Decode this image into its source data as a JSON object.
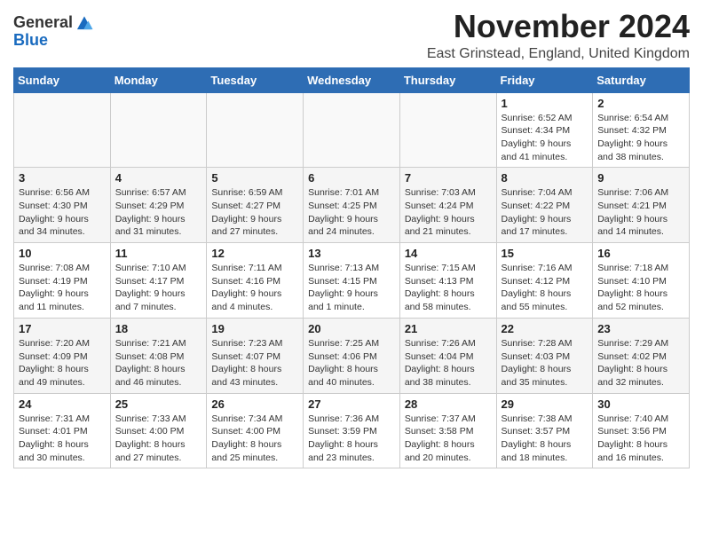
{
  "header": {
    "logo_general": "General",
    "logo_blue": "Blue",
    "month_title": "November 2024",
    "location": "East Grinstead, England, United Kingdom"
  },
  "days_of_week": [
    "Sunday",
    "Monday",
    "Tuesday",
    "Wednesday",
    "Thursday",
    "Friday",
    "Saturday"
  ],
  "weeks": [
    [
      {
        "day": "",
        "info": ""
      },
      {
        "day": "",
        "info": ""
      },
      {
        "day": "",
        "info": ""
      },
      {
        "day": "",
        "info": ""
      },
      {
        "day": "",
        "info": ""
      },
      {
        "day": "1",
        "info": "Sunrise: 6:52 AM\nSunset: 4:34 PM\nDaylight: 9 hours and 41 minutes."
      },
      {
        "day": "2",
        "info": "Sunrise: 6:54 AM\nSunset: 4:32 PM\nDaylight: 9 hours and 38 minutes."
      }
    ],
    [
      {
        "day": "3",
        "info": "Sunrise: 6:56 AM\nSunset: 4:30 PM\nDaylight: 9 hours and 34 minutes."
      },
      {
        "day": "4",
        "info": "Sunrise: 6:57 AM\nSunset: 4:29 PM\nDaylight: 9 hours and 31 minutes."
      },
      {
        "day": "5",
        "info": "Sunrise: 6:59 AM\nSunset: 4:27 PM\nDaylight: 9 hours and 27 minutes."
      },
      {
        "day": "6",
        "info": "Sunrise: 7:01 AM\nSunset: 4:25 PM\nDaylight: 9 hours and 24 minutes."
      },
      {
        "day": "7",
        "info": "Sunrise: 7:03 AM\nSunset: 4:24 PM\nDaylight: 9 hours and 21 minutes."
      },
      {
        "day": "8",
        "info": "Sunrise: 7:04 AM\nSunset: 4:22 PM\nDaylight: 9 hours and 17 minutes."
      },
      {
        "day": "9",
        "info": "Sunrise: 7:06 AM\nSunset: 4:21 PM\nDaylight: 9 hours and 14 minutes."
      }
    ],
    [
      {
        "day": "10",
        "info": "Sunrise: 7:08 AM\nSunset: 4:19 PM\nDaylight: 9 hours and 11 minutes."
      },
      {
        "day": "11",
        "info": "Sunrise: 7:10 AM\nSunset: 4:17 PM\nDaylight: 9 hours and 7 minutes."
      },
      {
        "day": "12",
        "info": "Sunrise: 7:11 AM\nSunset: 4:16 PM\nDaylight: 9 hours and 4 minutes."
      },
      {
        "day": "13",
        "info": "Sunrise: 7:13 AM\nSunset: 4:15 PM\nDaylight: 9 hours and 1 minute."
      },
      {
        "day": "14",
        "info": "Sunrise: 7:15 AM\nSunset: 4:13 PM\nDaylight: 8 hours and 58 minutes."
      },
      {
        "day": "15",
        "info": "Sunrise: 7:16 AM\nSunset: 4:12 PM\nDaylight: 8 hours and 55 minutes."
      },
      {
        "day": "16",
        "info": "Sunrise: 7:18 AM\nSunset: 4:10 PM\nDaylight: 8 hours and 52 minutes."
      }
    ],
    [
      {
        "day": "17",
        "info": "Sunrise: 7:20 AM\nSunset: 4:09 PM\nDaylight: 8 hours and 49 minutes."
      },
      {
        "day": "18",
        "info": "Sunrise: 7:21 AM\nSunset: 4:08 PM\nDaylight: 8 hours and 46 minutes."
      },
      {
        "day": "19",
        "info": "Sunrise: 7:23 AM\nSunset: 4:07 PM\nDaylight: 8 hours and 43 minutes."
      },
      {
        "day": "20",
        "info": "Sunrise: 7:25 AM\nSunset: 4:06 PM\nDaylight: 8 hours and 40 minutes."
      },
      {
        "day": "21",
        "info": "Sunrise: 7:26 AM\nSunset: 4:04 PM\nDaylight: 8 hours and 38 minutes."
      },
      {
        "day": "22",
        "info": "Sunrise: 7:28 AM\nSunset: 4:03 PM\nDaylight: 8 hours and 35 minutes."
      },
      {
        "day": "23",
        "info": "Sunrise: 7:29 AM\nSunset: 4:02 PM\nDaylight: 8 hours and 32 minutes."
      }
    ],
    [
      {
        "day": "24",
        "info": "Sunrise: 7:31 AM\nSunset: 4:01 PM\nDaylight: 8 hours and 30 minutes."
      },
      {
        "day": "25",
        "info": "Sunrise: 7:33 AM\nSunset: 4:00 PM\nDaylight: 8 hours and 27 minutes."
      },
      {
        "day": "26",
        "info": "Sunrise: 7:34 AM\nSunset: 4:00 PM\nDaylight: 8 hours and 25 minutes."
      },
      {
        "day": "27",
        "info": "Sunrise: 7:36 AM\nSunset: 3:59 PM\nDaylight: 8 hours and 23 minutes."
      },
      {
        "day": "28",
        "info": "Sunrise: 7:37 AM\nSunset: 3:58 PM\nDaylight: 8 hours and 20 minutes."
      },
      {
        "day": "29",
        "info": "Sunrise: 7:38 AM\nSunset: 3:57 PM\nDaylight: 8 hours and 18 minutes."
      },
      {
        "day": "30",
        "info": "Sunrise: 7:40 AM\nSunset: 3:56 PM\nDaylight: 8 hours and 16 minutes."
      }
    ]
  ]
}
